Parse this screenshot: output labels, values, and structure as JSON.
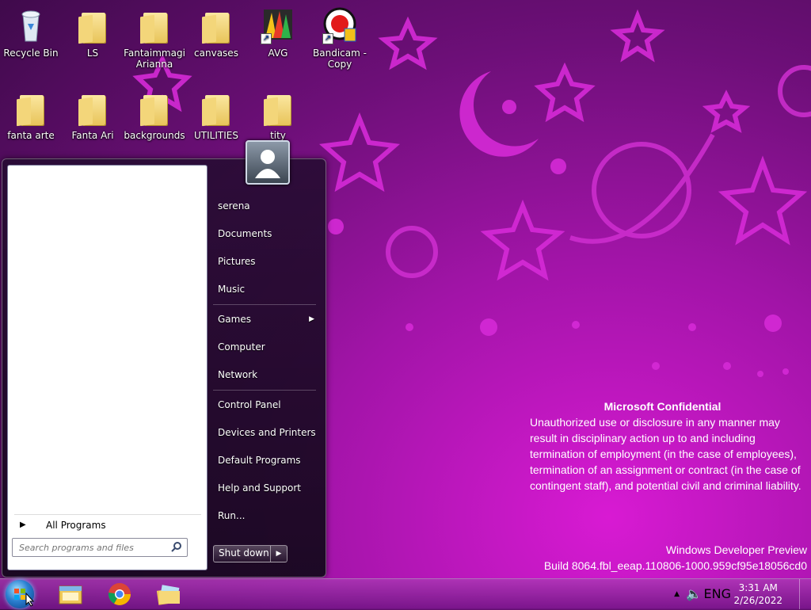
{
  "desktop": {
    "icons": [
      {
        "label": "Recycle Bin",
        "icon": "recycle-bin-icon"
      },
      {
        "label": "LS",
        "icon": "folder-icon"
      },
      {
        "label": "Fantaimmagi Arianna",
        "icon": "folder-icon"
      },
      {
        "label": "canvases",
        "icon": "folder-icon"
      },
      {
        "label": "AVG",
        "icon": "avg-icon"
      },
      {
        "label": "Bandicam - Copy",
        "icon": "bandicam-icon"
      },
      {
        "label": "fanta arte",
        "icon": "folder-icon"
      },
      {
        "label": "Fanta Ari",
        "icon": "folder-icon"
      },
      {
        "label": "backgrounds",
        "icon": "folder-icon"
      },
      {
        "label": "UTILITIES",
        "icon": "folder-icon"
      },
      {
        "label": "tity",
        "icon": "folder-icon"
      }
    ],
    "confidential_title": "Microsoft Confidential",
    "confidential_text": "Unauthorized use or disclosure in any manner may result in disciplinary action up to and including termination of employment (in the case of employees), termination of an assignment or contract (in the case of contingent staff), and potential civil and criminal liability.",
    "watermark_line1": "Windows Developer Preview",
    "watermark_line2": "Build 8064.fbl_eeap.110806-1000.959cf95e18056cd0"
  },
  "start_menu": {
    "all_programs": "All Programs",
    "search_placeholder": "Search programs and files",
    "right_items": [
      "serena",
      "Documents",
      "Pictures",
      "Music",
      "Games",
      "Computer",
      "Network",
      "Control Panel",
      "Devices and Printers",
      "Default Programs",
      "Help and Support",
      "Run..."
    ],
    "shutdown": "Shut down"
  },
  "taskbar": {
    "pinned": [
      "explorer-icon",
      "chrome-icon",
      "folders-icon"
    ],
    "language": "ENG",
    "time": "3:31 AM",
    "date": "2/26/2022"
  },
  "colors": {
    "accent": "#d81ad3",
    "wallpaper_dark": "#3f0a4b"
  }
}
